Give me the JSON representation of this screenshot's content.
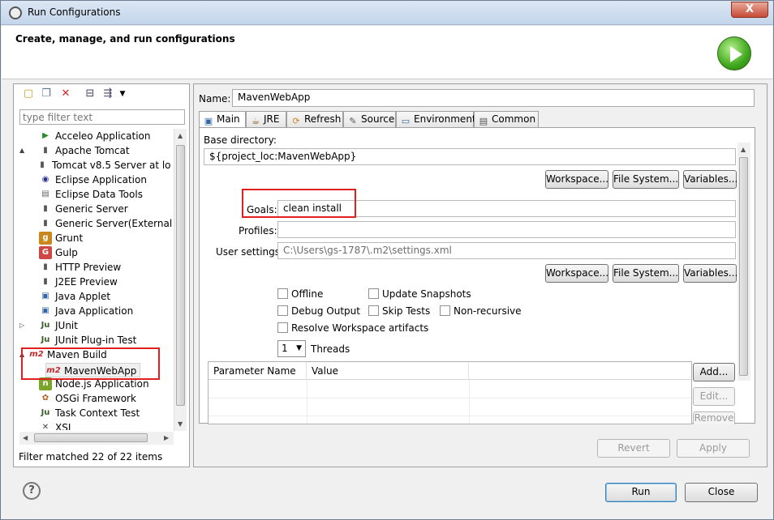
{
  "window": {
    "title": "Run Configurations",
    "close_label": "X",
    "header_title": "Create, manage, and run configurations"
  },
  "left": {
    "filter_placeholder": "type filter text",
    "status": "Filter matched 22 of 22 items",
    "tree": [
      {
        "label": "Acceleo Application",
        "icon": "acceleo-icon",
        "expander": ""
      },
      {
        "label": "Apache Tomcat",
        "icon": "tomcat-icon",
        "expander": "▲"
      },
      {
        "label": "Tomcat v8.5 Server at lo",
        "icon": "server-icon",
        "expander": ""
      },
      {
        "label": "Eclipse Application",
        "icon": "eclipse-icon",
        "expander": ""
      },
      {
        "label": "Eclipse Data Tools",
        "icon": "database-icon",
        "expander": ""
      },
      {
        "label": "Generic Server",
        "icon": "server-icon",
        "expander": ""
      },
      {
        "label": "Generic Server(External Laun",
        "icon": "server-icon",
        "expander": ""
      },
      {
        "label": "Grunt",
        "icon": "grunt-icon",
        "expander": ""
      },
      {
        "label": "Gulp",
        "icon": "gulp-icon",
        "expander": ""
      },
      {
        "label": "HTTP Preview",
        "icon": "server-icon",
        "expander": ""
      },
      {
        "label": "J2EE Preview",
        "icon": "server-icon",
        "expander": ""
      },
      {
        "label": "Java Applet",
        "icon": "applet-icon",
        "expander": ""
      },
      {
        "label": "Java Application",
        "icon": "java-app-icon",
        "expander": ""
      },
      {
        "label": "JUnit",
        "icon": "junit-icon",
        "expander": "▷"
      },
      {
        "label": "JUnit Plug-in Test",
        "icon": "junit-plugin-icon",
        "expander": ""
      },
      {
        "label": "Maven Build",
        "icon": "maven-icon",
        "expander": "▲"
      },
      {
        "label": "MavenWebApp",
        "icon": "maven-icon",
        "expander": ""
      },
      {
        "label": "Node.js Application",
        "icon": "nodejs-icon",
        "expander": ""
      },
      {
        "label": "OSGi Framework",
        "icon": "osgi-icon",
        "expander": ""
      },
      {
        "label": "Task Context Test",
        "icon": "task-icon",
        "expander": ""
      },
      {
        "label": "XSL",
        "icon": "xsl-icon",
        "expander": ""
      }
    ]
  },
  "right": {
    "name_label": "Name:",
    "name_value": "MavenWebApp",
    "tabs": [
      {
        "label": "Main",
        "icon": "main-tab-icon"
      },
      {
        "label": "JRE",
        "icon": "jre-tab-icon"
      },
      {
        "label": "Refresh",
        "icon": "refresh-tab-icon"
      },
      {
        "label": "Source",
        "icon": "source-tab-icon"
      },
      {
        "label": "Environment",
        "icon": "environment-tab-icon"
      },
      {
        "label": "Common",
        "icon": "common-tab-icon"
      }
    ],
    "base_dir_label": "Base directory:",
    "base_dir_value": "${project_loc:MavenWebApp}",
    "workspace_btn": "Workspace...",
    "filesystem_btn": "File System...",
    "variables_btn": "Variables...",
    "goals_label": "Goals:",
    "goals_value": "clean install",
    "profiles_label": "Profiles:",
    "profiles_value": "",
    "user_settings_label": "User settings:",
    "user_settings_value": "C:\\Users\\gs-1787\\.m2\\settings.xml",
    "offline": "Offline",
    "update_snapshots": "Update Snapshots",
    "debug_output": "Debug Output",
    "skip_tests": "Skip Tests",
    "non_recursive": "Non-recursive",
    "resolve_workspace": "Resolve Workspace artifacts",
    "threads_value": "1",
    "threads_label": "Threads",
    "param_col_name": "Parameter Name",
    "param_col_value": "Value",
    "add_btn": "Add...",
    "edit_btn": "Edit...",
    "remove_btn": "Remove",
    "revert_btn": "Revert",
    "apply_btn": "Apply"
  },
  "footer": {
    "run_btn": "Run",
    "close_btn": "Close",
    "help_label": "?"
  },
  "colors": {
    "highlight": "#e02020",
    "run_green": "#3fa71d"
  }
}
